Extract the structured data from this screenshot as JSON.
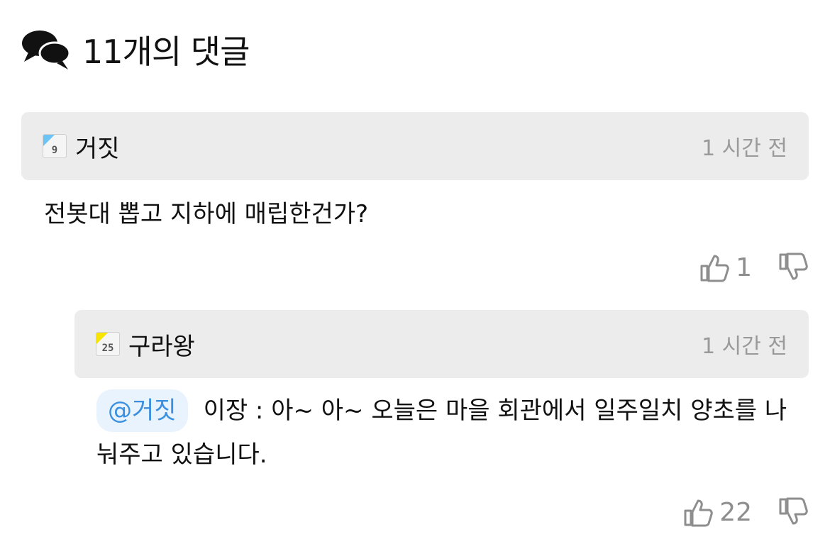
{
  "header": {
    "title": "11개의 댓글",
    "icon": "chat-bubbles-icon"
  },
  "comments": [
    {
      "author": "거짓",
      "badge": {
        "number": "9",
        "color": "#6cc3f5"
      },
      "time": "1 시간 전",
      "text": "전봇대 뽑고 지하에 매립한건가?",
      "likes": "1"
    }
  ],
  "reply": {
    "author": "구라왕",
    "badge": {
      "number": "25",
      "color": "#f7e400"
    },
    "time": "1 시간 전",
    "mention": "@거짓",
    "text": "이장 : 아~ 아~ 오늘은 마을 회관에서 일주일치 양초를 나눠주고 있습니다.",
    "likes": "22"
  }
}
